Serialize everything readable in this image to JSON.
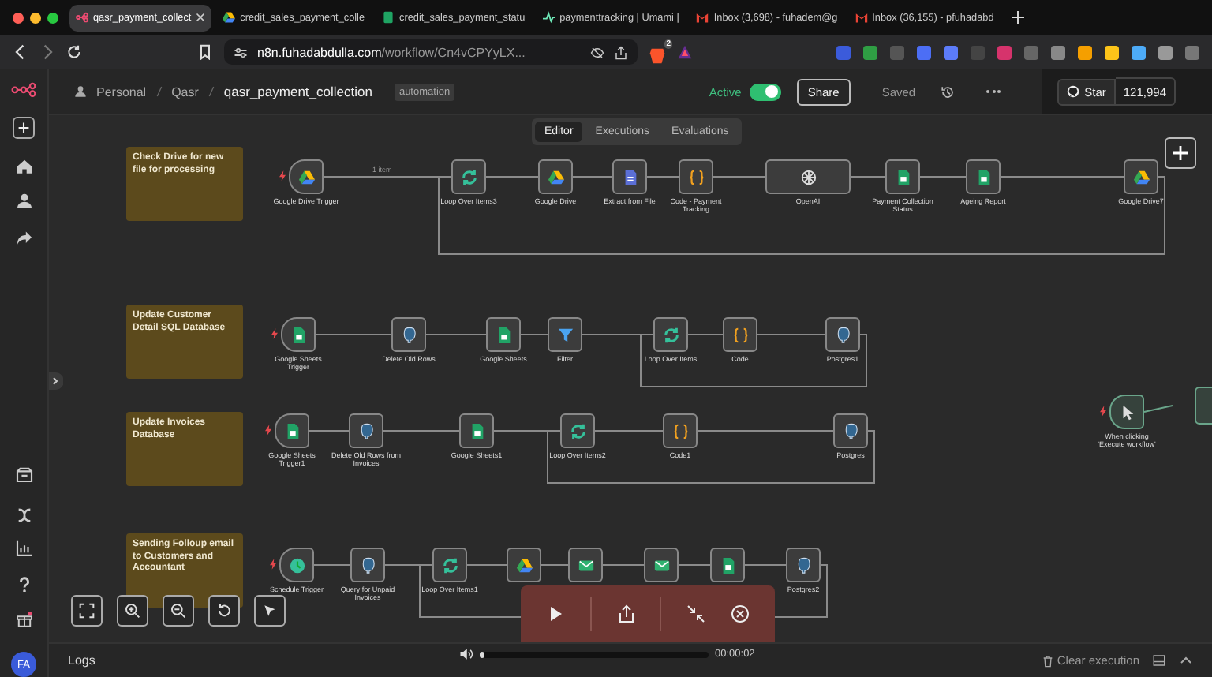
{
  "browser": {
    "tabs": [
      {
        "title": "qasr_payment_collect",
        "selected": true
      },
      {
        "title": "credit_sales_payment_colle",
        "selected": false
      },
      {
        "title": "credit_sales_payment_statu",
        "selected": false
      },
      {
        "title": "paymenttracking | Umami |",
        "selected": false
      },
      {
        "title": "Inbox (3,698) - fuhadem@g",
        "selected": false
      },
      {
        "title": "Inbox (36,155) - pfuhadabd",
        "selected": false
      }
    ],
    "url_host": "n8n.fuhadabdulla.com",
    "url_path": "/workflow/Cn4vCPYyLX...",
    "shield_count": "2"
  },
  "header": {
    "breadcrumbs": [
      "Personal",
      "Qasr"
    ],
    "workflow_name": "qasr_payment_collection",
    "tag": "automation",
    "active_label": "Active",
    "active": true,
    "share": "Share",
    "saved": "Saved",
    "star": "Star",
    "star_count": "121,994"
  },
  "view_tabs": [
    {
      "label": "Editor",
      "selected": true
    },
    {
      "label": "Executions",
      "selected": false
    },
    {
      "label": "Evaluations",
      "selected": false
    }
  ],
  "sticky_notes": [
    {
      "title": "Check Drive for new file for processing"
    },
    {
      "title": "Update Customer Detail SQL Database"
    },
    {
      "title": "Update Invoices Database"
    },
    {
      "title": "Sending Folloup email to Customers and Accountant"
    }
  ],
  "workflows": [
    {
      "edge_label": "1 item",
      "nodes": [
        {
          "label": "Google Drive Trigger",
          "kind": "drive",
          "trigger": true
        },
        {
          "label": "Loop Over Items3",
          "kind": "loop",
          "trigger": false
        },
        {
          "label": "Google Drive",
          "kind": "drive",
          "trigger": false
        },
        {
          "label": "Extract from File",
          "kind": "file",
          "trigger": false
        },
        {
          "label": "Code - Payment Tracking",
          "kind": "code",
          "trigger": false
        },
        {
          "label": "OpenAI",
          "kind": "openai",
          "trigger": false
        },
        {
          "label": "Payment Collection Status",
          "kind": "sheets",
          "trigger": false
        },
        {
          "label": "Ageing Report",
          "kind": "sheets",
          "trigger": false
        },
        {
          "label": "Google Drive7",
          "kind": "drive",
          "trigger": false
        }
      ]
    },
    {
      "nodes": [
        {
          "label": "Google Sheets Trigger",
          "kind": "sheets",
          "trigger": true
        },
        {
          "label": "Delete Old Rows",
          "kind": "postgres",
          "trigger": false
        },
        {
          "label": "Google Sheets",
          "kind": "sheets",
          "trigger": false
        },
        {
          "label": "Filter",
          "kind": "filter",
          "trigger": false
        },
        {
          "label": "Loop Over Items",
          "kind": "loop",
          "trigger": false
        },
        {
          "label": "Code",
          "kind": "code",
          "trigger": false
        },
        {
          "label": "Postgres1",
          "kind": "postgres",
          "trigger": false
        }
      ]
    },
    {
      "nodes": [
        {
          "label": "Google Sheets Trigger1",
          "kind": "sheets",
          "trigger": true
        },
        {
          "label": "Delete Old Rows from Invoices",
          "kind": "postgres",
          "trigger": false
        },
        {
          "label": "Google Sheets1",
          "kind": "sheets",
          "trigger": false
        },
        {
          "label": "Loop Over Items2",
          "kind": "loop",
          "trigger": false
        },
        {
          "label": "Code1",
          "kind": "code",
          "trigger": false
        },
        {
          "label": "Postgres",
          "kind": "postgres",
          "trigger": false
        }
      ]
    },
    {
      "nodes": [
        {
          "label": "Schedule Trigger",
          "kind": "schedule",
          "trigger": true
        },
        {
          "label": "Query for Unpaid Invoices",
          "kind": "postgres",
          "trigger": false
        },
        {
          "label": "Loop Over Items1",
          "kind": "loop",
          "trigger": false
        },
        {
          "kind": "drive",
          "trigger": false
        },
        {
          "kind": "gmail",
          "trigger": false
        },
        {
          "kind": "gmail",
          "trigger": false
        },
        {
          "kind": "sheets",
          "trigger": false
        },
        {
          "label": "Postgres2",
          "kind": "postgres",
          "trigger": false
        }
      ]
    }
  ],
  "manual_trigger": {
    "label": "When clicking 'Execute workflow'",
    "kind": "cursor",
    "trigger": true
  },
  "player": {
    "time": "00:00:02",
    "level": 0.02
  },
  "logs": {
    "title": "Logs",
    "clear": "Clear execution"
  },
  "user": {
    "initials": "FA"
  }
}
